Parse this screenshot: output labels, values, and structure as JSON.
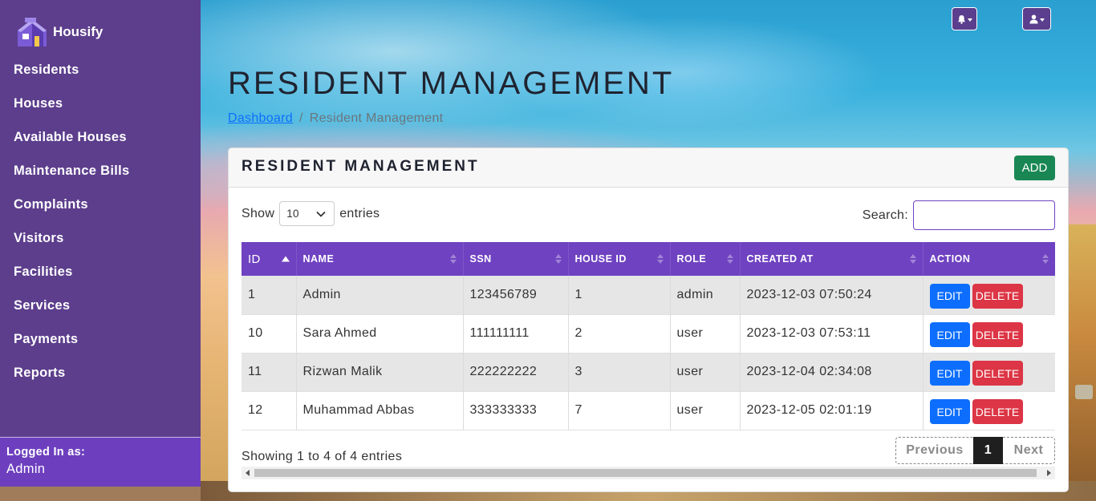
{
  "app": {
    "name": "Housify"
  },
  "sidebar": {
    "items": [
      {
        "label": "Residents"
      },
      {
        "label": "Houses"
      },
      {
        "label": "Available Houses"
      },
      {
        "label": "Maintenance Bills"
      },
      {
        "label": "Complaints"
      },
      {
        "label": "Visitors"
      },
      {
        "label": "Facilities"
      },
      {
        "label": "Services"
      },
      {
        "label": "Payments"
      },
      {
        "label": "Reports"
      }
    ],
    "logged_in_label": "Logged In as:",
    "logged_in_user": "Admin"
  },
  "header": {
    "bell_icon": "bell-icon",
    "user_icon": "user-icon"
  },
  "page": {
    "title": "RESIDENT MANAGEMENT",
    "breadcrumb": {
      "link": "Dashboard",
      "separator": "/",
      "current": "Resident Management"
    }
  },
  "card": {
    "title": "RESIDENT MANAGEMENT",
    "add_label": "ADD",
    "show_label": "Show",
    "entries_label": "entries",
    "page_size": "10",
    "search_label": "Search:",
    "search_value": ""
  },
  "table": {
    "columns": [
      "ID",
      "NAME",
      "SSN",
      "HOUSE ID",
      "ROLE",
      "CREATED AT",
      "ACTION"
    ],
    "rows": [
      {
        "id": "1",
        "name": "Admin",
        "ssn": "123456789",
        "house_id": "1",
        "role": "admin",
        "created_at": "2023-12-03 07:50:24"
      },
      {
        "id": "10",
        "name": "Sara Ahmed",
        "ssn": "111111111",
        "house_id": "2",
        "role": "user",
        "created_at": "2023-12-03 07:53:11"
      },
      {
        "id": "11",
        "name": "Rizwan Malik",
        "ssn": "222222222",
        "house_id": "3",
        "role": "user",
        "created_at": "2023-12-04 02:34:08"
      },
      {
        "id": "12",
        "name": "Muhammad Abbas",
        "ssn": "333333333",
        "house_id": "7",
        "role": "user",
        "created_at": "2023-12-05 02:01:19"
      }
    ],
    "edit_label": "EDIT",
    "delete_label": "DELETE"
  },
  "footer": {
    "info": "Showing 1 to 4 of 4 entries",
    "prev": "Previous",
    "page": "1",
    "next": "Next"
  },
  "colors": {
    "sidebar": "#5c3e8c",
    "accent": "#6f42c1",
    "add": "#198754",
    "edit": "#0d6efd",
    "delete": "#dc3545"
  }
}
